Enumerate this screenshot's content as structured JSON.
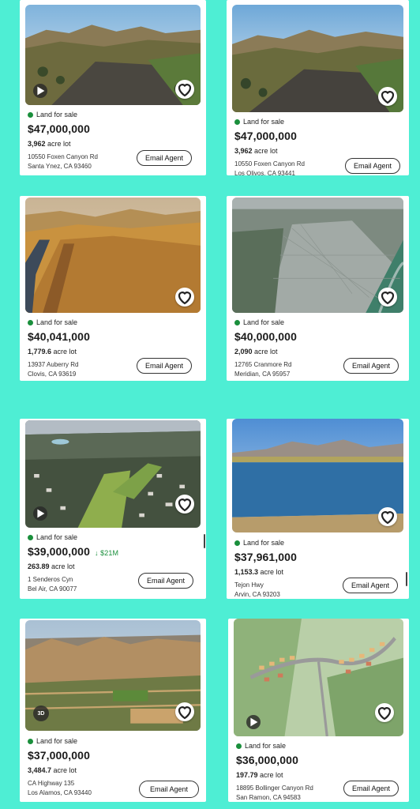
{
  "listings": [
    {
      "status": "Land for sale",
      "price": "$47,000,000",
      "acres": "3,962",
      "acre_suffix": "acre lot",
      "street": "10550 Foxen Canyon Rd",
      "city": "Santa Ynez, CA 93460",
      "email_label": "Email Agent",
      "video_icon": "play-icon",
      "heart_icon": "heart-icon"
    },
    {
      "status": "Land for sale",
      "price": "$47,000,000",
      "acres": "3,962",
      "acre_suffix": "acre lot",
      "street": "10550 Foxen Canyon Rd",
      "city": "Los Olivos, CA 93441",
      "email_label": "Email Agent",
      "heart_icon": "heart-icon"
    },
    {
      "status": "Land for sale",
      "price": "$40,041,000",
      "acres": "1,779.6",
      "acre_suffix": "acre lot",
      "street": "13937 Auberry Rd",
      "city": "Clovis, CA 93619",
      "email_label": "Email Agent",
      "heart_icon": "heart-icon"
    },
    {
      "status": "Land for sale",
      "price": "$40,000,000",
      "acres": "2,090",
      "acre_suffix": "acre lot",
      "street": "12765 Cranmore Rd",
      "city": "Meridian, CA 95957",
      "email_label": "Email Agent",
      "heart_icon": "heart-icon"
    },
    {
      "status": "Land for sale",
      "price": "$39,000,000",
      "price_drop": "↓ $21M",
      "acres": "263.89",
      "acre_suffix": "acre lot",
      "street": "1 Senderos Cyn",
      "city": "Bel Air, CA 90077",
      "email_label": "Email Agent",
      "video_icon": "play-icon",
      "heart_icon": "heart-icon"
    },
    {
      "status": "Land for sale",
      "price": "$37,961,000",
      "acres": "1,153.3",
      "acre_suffix": "acre lot",
      "street": "Tejon Hwy",
      "city": "Arvin, CA 93203",
      "email_label": "Email Agent",
      "heart_icon": "heart-icon"
    },
    {
      "status": "Land for sale",
      "price": "$37,000,000",
      "acres": "3,484.7",
      "acre_suffix": "acre lot",
      "street": "CA Highway 135",
      "city": "Los Alamos, CA 93440",
      "email_label": "Email Agent",
      "badge_3d": "3D",
      "heart_icon": "heart-icon"
    },
    {
      "status": "Land for sale",
      "price": "$36,000,000",
      "acres": "197.79",
      "acre_suffix": "acre lot",
      "street": "18895 Bollinger Canyon Rd",
      "city": "San Ramon, CA 94583",
      "email_label": "Email Agent",
      "video_icon": "play-icon",
      "heart_icon": "heart-icon"
    }
  ],
  "colors": {
    "background": "#4eeed4",
    "status_dot": "#1a8f3c",
    "price_drop": "#1a8f3c"
  }
}
